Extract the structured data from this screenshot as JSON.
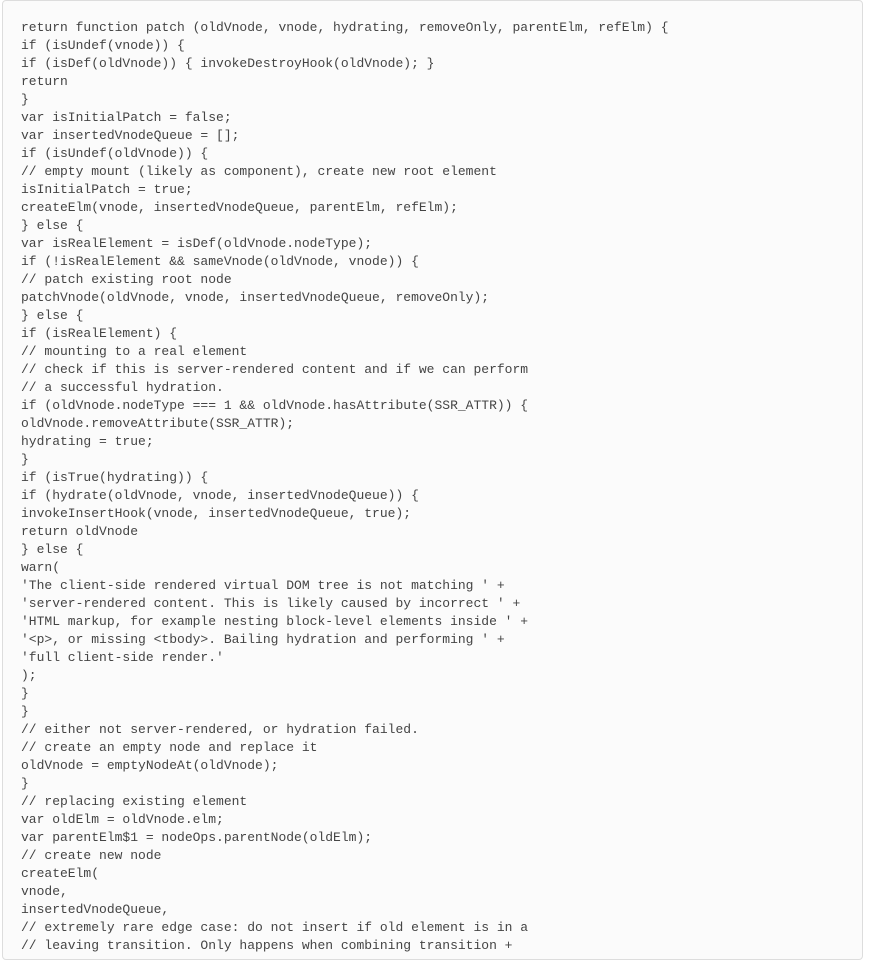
{
  "code": {
    "lines": [
      "return function patch (oldVnode, vnode, hydrating, removeOnly, parentElm, refElm) {",
      "if (isUndef(vnode)) {",
      "if (isDef(oldVnode)) { invokeDestroyHook(oldVnode); }",
      "return",
      "}",
      "var isInitialPatch = false;",
      "var insertedVnodeQueue = [];",
      "if (isUndef(oldVnode)) {",
      "// empty mount (likely as component), create new root element",
      "isInitialPatch = true;",
      "createElm(vnode, insertedVnodeQueue, parentElm, refElm);",
      "} else {",
      "var isRealElement = isDef(oldVnode.nodeType);",
      "if (!isRealElement && sameVnode(oldVnode, vnode)) {",
      "// patch existing root node",
      "patchVnode(oldVnode, vnode, insertedVnodeQueue, removeOnly);",
      "} else {",
      "if (isRealElement) {",
      "// mounting to a real element",
      "// check if this is server-rendered content and if we can perform",
      "// a successful hydration.",
      "if (oldVnode.nodeType === 1 && oldVnode.hasAttribute(SSR_ATTR)) {",
      "oldVnode.removeAttribute(SSR_ATTR);",
      "hydrating = true;",
      "}",
      "if (isTrue(hydrating)) {",
      "if (hydrate(oldVnode, vnode, insertedVnodeQueue)) {",
      "invokeInsertHook(vnode, insertedVnodeQueue, true);",
      "return oldVnode",
      "} else {",
      "warn(",
      "'The client-side rendered virtual DOM tree is not matching ' +",
      "'server-rendered content. This is likely caused by incorrect ' +",
      "'HTML markup, for example nesting block-level elements inside ' +",
      "'<p>, or missing <tbody>. Bailing hydration and performing ' +",
      "'full client-side render.'",
      ");",
      "}",
      "}",
      "// either not server-rendered, or hydration failed.",
      "// create an empty node and replace it",
      "oldVnode = emptyNodeAt(oldVnode);",
      "}",
      "// replacing existing element",
      "var oldElm = oldVnode.elm;",
      "var parentElm$1 = nodeOps.parentNode(oldElm);",
      "// create new node",
      "createElm(",
      "vnode,",
      "insertedVnodeQueue,",
      "// extremely rare edge case: do not insert if old element is in a",
      "// leaving transition. Only happens when combining transition +"
    ]
  }
}
